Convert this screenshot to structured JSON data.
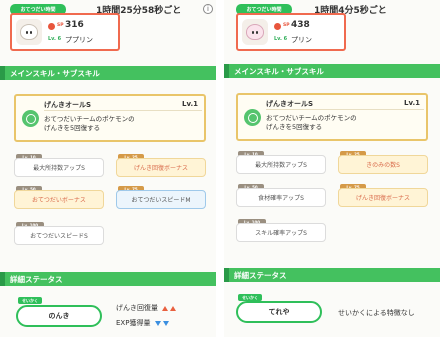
{
  "left": {
    "helper_badge": "おてつだい時間",
    "interval": "1時間25分58秒ごと",
    "pokemon": {
      "sp_label": "SP",
      "sp_value": "316",
      "level": "Lv. 6",
      "name": "ププリン"
    },
    "section_skills": "メインスキル・サブスキル",
    "main_skill": {
      "name": "げんきオールS",
      "level": "Lv.1",
      "desc_line1": "おてつだいチームのポケモンの",
      "desc_line2": "げんきを5回復する"
    },
    "sub_skills": [
      {
        "level": "Lv. 10",
        "label": "最大所持数アップS",
        "style": "white"
      },
      {
        "level": "Lv. 25",
        "label": "げんき回復ボーナス",
        "style": "gold"
      },
      {
        "level": "Lv. 50",
        "label": "おてつだいボーナス",
        "style": "gold"
      },
      {
        "level": "Lv. 75",
        "label": "おてつだいスピードM",
        "style": "blue"
      },
      {
        "level": "Lv. 100",
        "label": "おてつだいスピードS",
        "style": "white"
      }
    ],
    "section_stats": "詳細ステータス",
    "nature_tag": "せいかく",
    "nature": "のんき",
    "stats": [
      {
        "label": "げんき回復量",
        "arrows": "up2"
      },
      {
        "label": "EXP獲得量",
        "arrows": "down2"
      }
    ]
  },
  "right": {
    "helper_badge": "おてつだい時間",
    "interval": "1時間4分5秒ごと",
    "pokemon": {
      "sp_label": "SP",
      "sp_value": "438",
      "level": "Lv. 6",
      "name": "プリン"
    },
    "section_skills": "メインスキル・サブスキル",
    "main_skill": {
      "name": "げんきオールS",
      "level": "Lv.1",
      "desc_line1": "おてつだいチームのポケモンの",
      "desc_line2": "げんきを5回復する"
    },
    "sub_skills": [
      {
        "level": "Lv. 10",
        "label": "最大所持数アップS",
        "style": "white"
      },
      {
        "level": "Lv. 25",
        "label": "きのみの数S",
        "style": "gold"
      },
      {
        "level": "Lv. 50",
        "label": "食材確率アップS",
        "style": "white"
      },
      {
        "level": "Lv. 75",
        "label": "げんき回復ボーナス",
        "style": "gold"
      },
      {
        "level": "Lv. 100",
        "label": "スキル確率アップS",
        "style": "white"
      }
    ],
    "section_stats": "詳細ステータス",
    "nature_tag": "せいかく",
    "nature": "てれや",
    "nature_note": "せいかくによる特徴なし"
  },
  "colors": {
    "accent_green": "#44c15f",
    "card_border_red": "#f06a4f",
    "skill_border_gold": "#e9c56a",
    "arrow_up": "#e9603f",
    "arrow_down": "#3b8fe0"
  },
  "icons": {
    "info": "info-icon",
    "pokemon": "pokemon-avatar-icon",
    "sp": "sp-icon",
    "skill": "smile-skill-icon"
  }
}
